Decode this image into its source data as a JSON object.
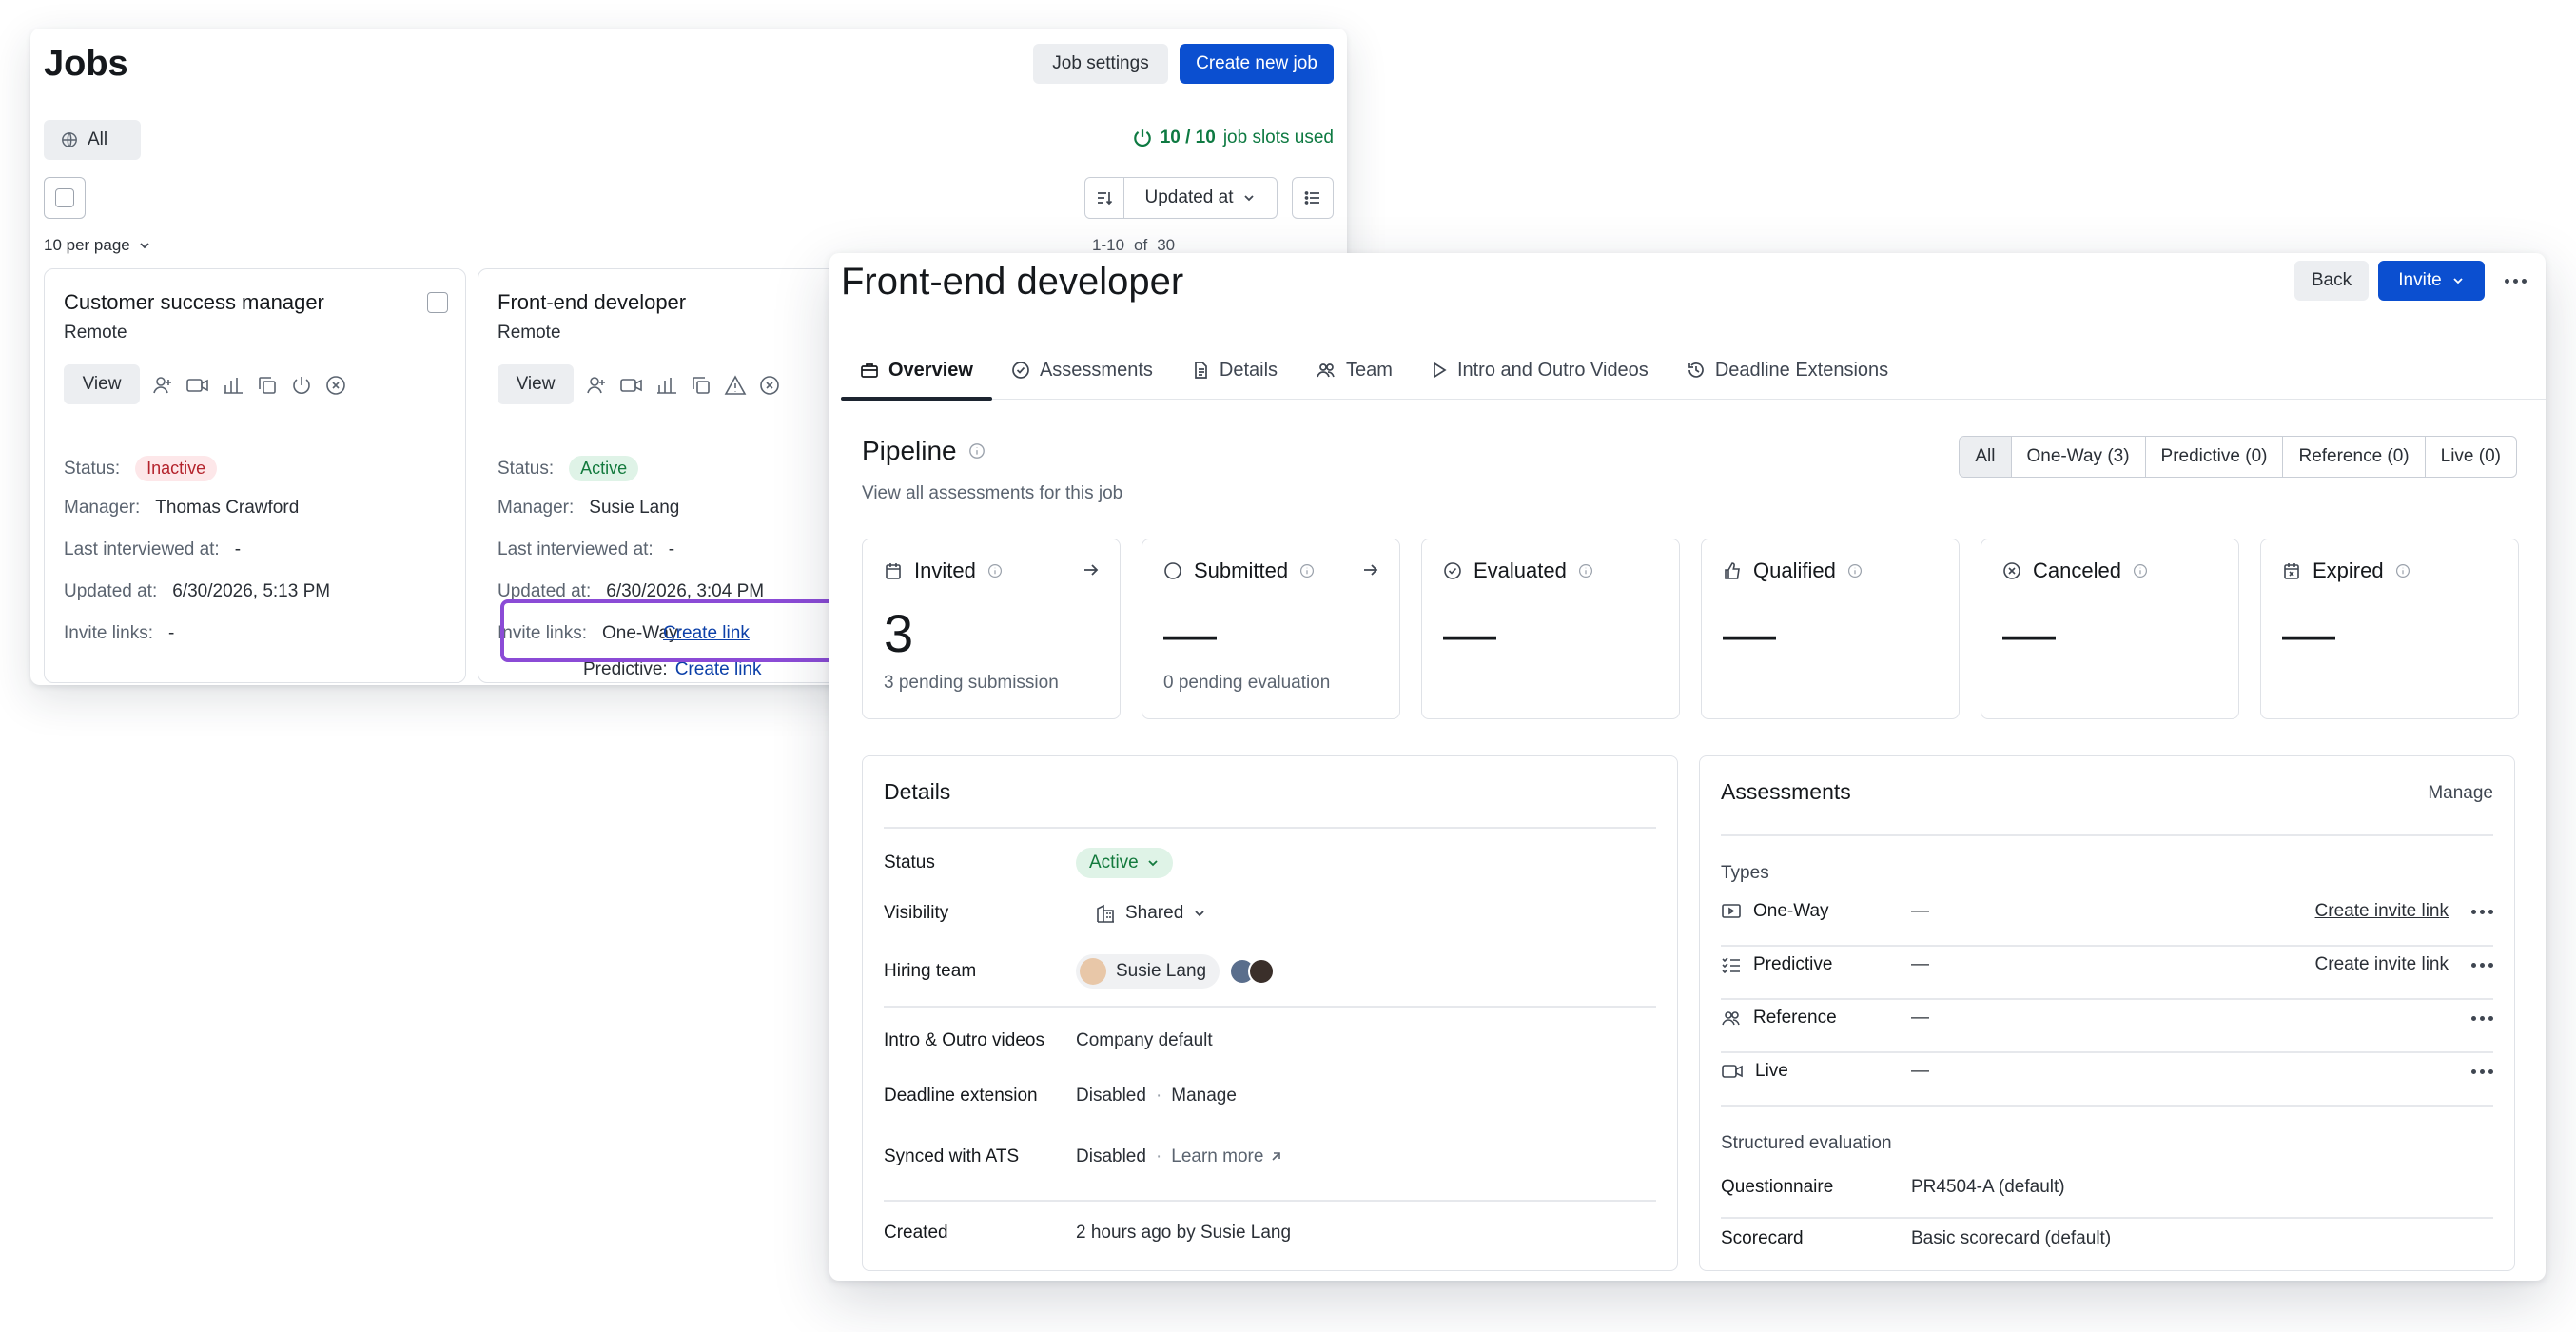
{
  "jobs": {
    "title": "Jobs",
    "job_settings": "Job settings",
    "create_new_job": "Create new job",
    "filter_all": "All",
    "slots_used": "10 / 10",
    "slots_suffix": "job slots used",
    "sort_label": "Updated at",
    "per_page": "10 per page",
    "range": "1-10",
    "of": "of",
    "total": "30",
    "cards": [
      {
        "title": "Customer success manager",
        "location": "Remote",
        "view": "View",
        "status_label": "Status:",
        "status": "Inactive",
        "manager_label": "Manager:",
        "manager": "Thomas Crawford",
        "last_label": "Last interviewed at:",
        "last": "-",
        "updated_label": "Updated at:",
        "updated": "6/30/2026, 5:13 PM",
        "invite_label": "Invite links:",
        "invite": "-"
      },
      {
        "title": "Front-end developer",
        "location": "Remote",
        "view": "View",
        "status_label": "Status:",
        "status": "Active",
        "manager_label": "Manager:",
        "manager": "Susie Lang",
        "last_label": "Last interviewed at:",
        "last": "-",
        "updated_label": "Updated at:",
        "updated": "6/30/2026, 3:04 PM",
        "invite_label": "Invite links:",
        "oneway_label": "One-Way:",
        "oneway_link": "Create link",
        "predictive_label": "Predictive:",
        "predictive_link": "Create link"
      }
    ]
  },
  "detail": {
    "title": "Front-end developer",
    "back": "Back",
    "invite": "Invite",
    "tabs": [
      "Overview",
      "Assessments",
      "Details",
      "Team",
      "Intro and Outro Videos",
      "Deadline Extensions"
    ],
    "pipeline_title": "Pipeline",
    "pipeline_sub": "View all assessments for this job",
    "filters": [
      "All",
      "One-Way (3)",
      "Predictive (0)",
      "Reference (0)",
      "Live (0)"
    ],
    "stats": [
      {
        "label": "Invited",
        "value": "3",
        "sub": "3 pending submission"
      },
      {
        "label": "Submitted",
        "value": "—",
        "sub": "0 pending evaluation"
      },
      {
        "label": "Evaluated",
        "value": "—"
      },
      {
        "label": "Qualified",
        "value": "—"
      },
      {
        "label": "Canceled",
        "value": "—"
      },
      {
        "label": "Expired",
        "value": "—"
      }
    ],
    "details": {
      "title": "Details",
      "status_label": "Status",
      "status": "Active",
      "visibility_label": "Visibility",
      "visibility": "Shared",
      "hiring_team_label": "Hiring team",
      "hiring_member": "Susie Lang",
      "intro_label": "Intro & Outro videos",
      "intro": "Company default",
      "deadline_label": "Deadline extension",
      "deadline": "Disabled",
      "deadline_action": "Manage",
      "ats_label": "Synced with ATS",
      "ats": "Disabled",
      "ats_action": "Learn more",
      "created_label": "Created",
      "created": "2 hours ago by Susie Lang"
    },
    "assessments": {
      "title": "Assessments",
      "manage": "Manage",
      "types_label": "Types",
      "types": [
        {
          "name": "One-Way",
          "value": "—",
          "action": "Create invite link"
        },
        {
          "name": "Predictive",
          "value": "—",
          "action": "Create invite link"
        },
        {
          "name": "Reference",
          "value": "—"
        },
        {
          "name": "Live",
          "value": "—"
        }
      ],
      "structured_label": "Structured evaluation",
      "questionnaire_label": "Questionnaire",
      "questionnaire": "PR4504-A (default)",
      "scorecard_label": "Scorecard",
      "scorecard": "Basic scorecard (default)"
    }
  },
  "colors": {
    "primary": "#0b4fd0",
    "success": "#137a3d",
    "danger": "#b4232c",
    "highlight": "#8b4bd6"
  }
}
